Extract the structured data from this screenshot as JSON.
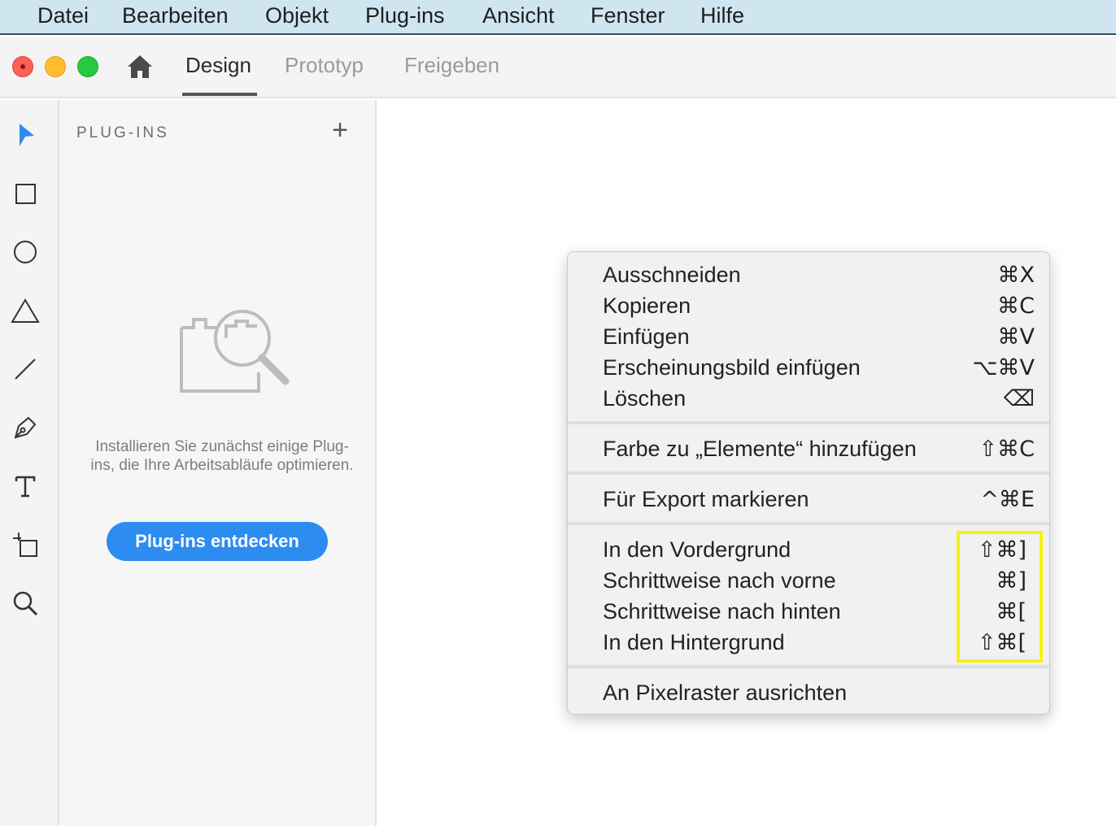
{
  "menubar": {
    "apple_glyph": ")",
    "items": [
      "Datei",
      "Bearbeiten",
      "Objekt",
      "Plug-ins",
      "Ansicht",
      "Fenster",
      "Hilfe"
    ]
  },
  "window": {
    "home_icon": "home-icon",
    "tabs": [
      {
        "label": "Design",
        "active": true
      },
      {
        "label": "Prototyp",
        "active": false
      },
      {
        "label": "Freigeben",
        "active": false
      }
    ]
  },
  "tools": [
    {
      "icon": "select-arrow-icon",
      "active": true,
      "color": "#2d8cf0"
    },
    {
      "icon": "rectangle-icon"
    },
    {
      "icon": "ellipse-icon"
    },
    {
      "icon": "triangle-icon"
    },
    {
      "icon": "line-icon"
    },
    {
      "icon": "pen-icon"
    },
    {
      "icon": "text-icon"
    },
    {
      "icon": "artboard-icon"
    },
    {
      "icon": "zoom-icon"
    }
  ],
  "panel": {
    "title": "PLUG-INS",
    "add_glyph": "+",
    "empty_message": "Installieren Sie zunächst einige Plug-ins, die Ihre Arbeitsabläufe optimieren.",
    "discover_button": "Plug-ins entdecken",
    "accent_color": "#2d8cf0"
  },
  "context_menu": {
    "groups": [
      [
        {
          "label": "Ausschneiden",
          "shortcut": "⌘X"
        },
        {
          "label": "Kopieren",
          "shortcut": "⌘C"
        },
        {
          "label": "Einfügen",
          "shortcut": "⌘V"
        },
        {
          "label": "Erscheinungsbild einfügen",
          "shortcut": "⌥⌘V"
        },
        {
          "label": "Löschen",
          "shortcut": "⌫"
        }
      ],
      [
        {
          "label": "Farbe zu „Elemente“ hinzufügen",
          "shortcut": "⇧⌘C"
        }
      ],
      [
        {
          "label": "Für Export markieren",
          "shortcut": "^⌘E"
        }
      ],
      [
        {
          "label": "In den Vordergrund",
          "shortcut": "⇧⌘]"
        },
        {
          "label": "Schrittweise nach vorne",
          "shortcut": "⌘]"
        },
        {
          "label": "Schrittweise nach hinten",
          "shortcut": "⌘["
        },
        {
          "label": "In den Hintergrund",
          "shortcut": "⇧⌘["
        }
      ],
      [
        {
          "label": "An Pixelraster ausrichten",
          "shortcut": ""
        }
      ]
    ],
    "highlight_color": "#f5f216"
  }
}
